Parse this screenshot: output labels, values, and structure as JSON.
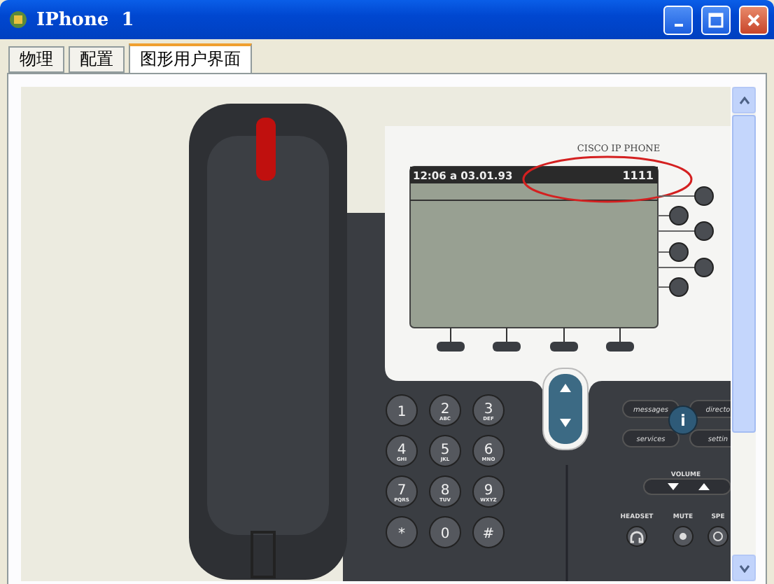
{
  "window": {
    "title": "IPhone  1"
  },
  "tabs": [
    {
      "label": "物理",
      "selected": false
    },
    {
      "label": "配置",
      "selected": false
    },
    {
      "label": "图形用户界面",
      "selected": true
    }
  ],
  "phone": {
    "brand": "CISCO IP PHONE",
    "screen": {
      "datetime": "12:06 a 03.01.93",
      "line_number": "1111"
    },
    "keypad": [
      {
        "digit": "1"
      },
      {
        "digit": "2",
        "letters": "ABC"
      },
      {
        "digit": "3",
        "letters": "DEF"
      },
      {
        "digit": "4",
        "letters": "GHI"
      },
      {
        "digit": "5",
        "letters": "JKL"
      },
      {
        "digit": "6",
        "letters": "MNO"
      },
      {
        "digit": "7",
        "letters": "PQRS"
      },
      {
        "digit": "8",
        "letters": "TUV"
      },
      {
        "digit": "9",
        "letters": "WXYZ"
      },
      {
        "digit": "*"
      },
      {
        "digit": "0"
      },
      {
        "digit": "#"
      }
    ],
    "feature_buttons": [
      "messages",
      "directo",
      "services",
      "settin"
    ],
    "info_button": "i",
    "volume_label": "VOLUME",
    "bottom_buttons": [
      {
        "label": "HEADSET",
        "kind": "headset"
      },
      {
        "label": "MUTE",
        "kind": "mute"
      },
      {
        "label": "SPE",
        "kind": "speaker"
      }
    ]
  }
}
